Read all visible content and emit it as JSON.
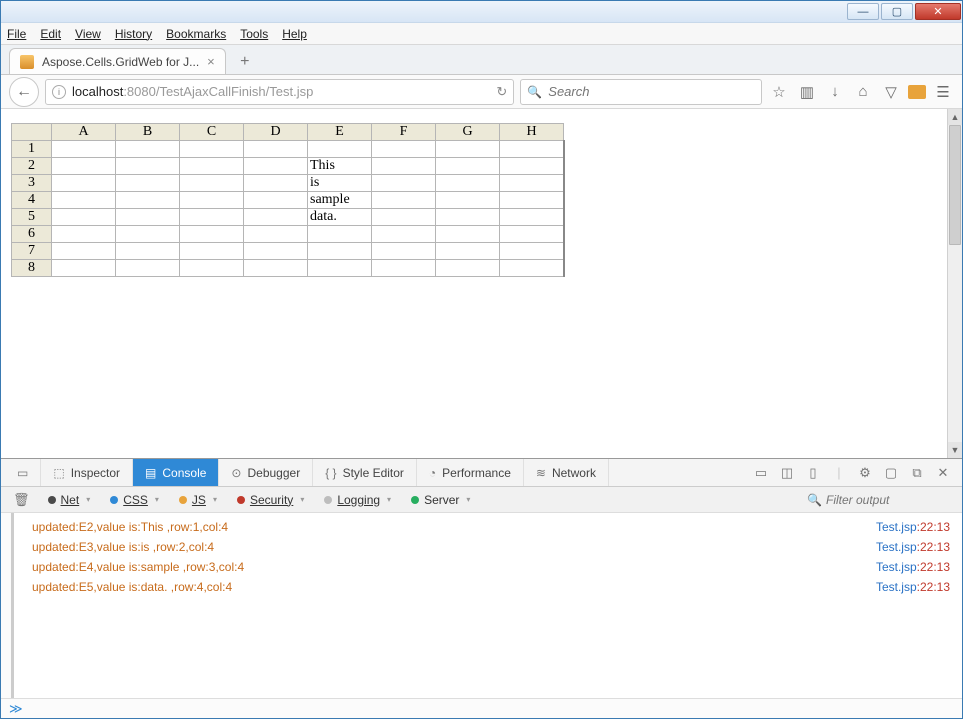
{
  "window": {
    "minimize": "—",
    "maximize": "▢",
    "close": "✕"
  },
  "menubar": [
    "File",
    "Edit",
    "View",
    "History",
    "Bookmarks",
    "Tools",
    "Help"
  ],
  "tab": {
    "title": "Aspose.Cells.GridWeb for J..."
  },
  "navbar": {
    "url_host": "localhost",
    "url_port_path": ":8080/TestAjaxCallFinish/Test.jsp",
    "search_placeholder": "Search"
  },
  "grid": {
    "columns": [
      "A",
      "B",
      "C",
      "D",
      "E",
      "F",
      "G",
      "H"
    ],
    "rows": [
      "1",
      "2",
      "3",
      "4",
      "5",
      "6",
      "7",
      "8"
    ],
    "cells": {
      "E2": "This",
      "E3": "is",
      "E4": "sample",
      "E5": "data."
    }
  },
  "devtools": {
    "tabs": {
      "inspector": "Inspector",
      "console": "Console",
      "debugger": "Debugger",
      "style": "Style Editor",
      "performance": "Performance",
      "network": "Network"
    },
    "filters": {
      "net": "Net",
      "css": "CSS",
      "js": "JS",
      "security": "Security",
      "logging": "Logging",
      "server": "Server"
    },
    "filter_placeholder": "Filter output",
    "console_lines": [
      {
        "msg": "updated:E2,value is:This ,row:1,col:4",
        "src": "Test.jsp",
        "line": "22:13"
      },
      {
        "msg": "updated:E3,value is:is ,row:2,col:4",
        "src": "Test.jsp",
        "line": "22:13"
      },
      {
        "msg": "updated:E4,value is:sample ,row:3,col:4",
        "src": "Test.jsp",
        "line": "22:13"
      },
      {
        "msg": "updated:E5,value is:data. ,row:4,col:4",
        "src": "Test.jsp",
        "line": "22:13"
      }
    ],
    "prompt": "≫"
  },
  "colors": {
    "net": "#4a4a4a",
    "css": "#2f89d6",
    "js": "#e8a33b",
    "security": "#c0392b",
    "logging": "#bdbdbd",
    "server": "#27ae60"
  }
}
